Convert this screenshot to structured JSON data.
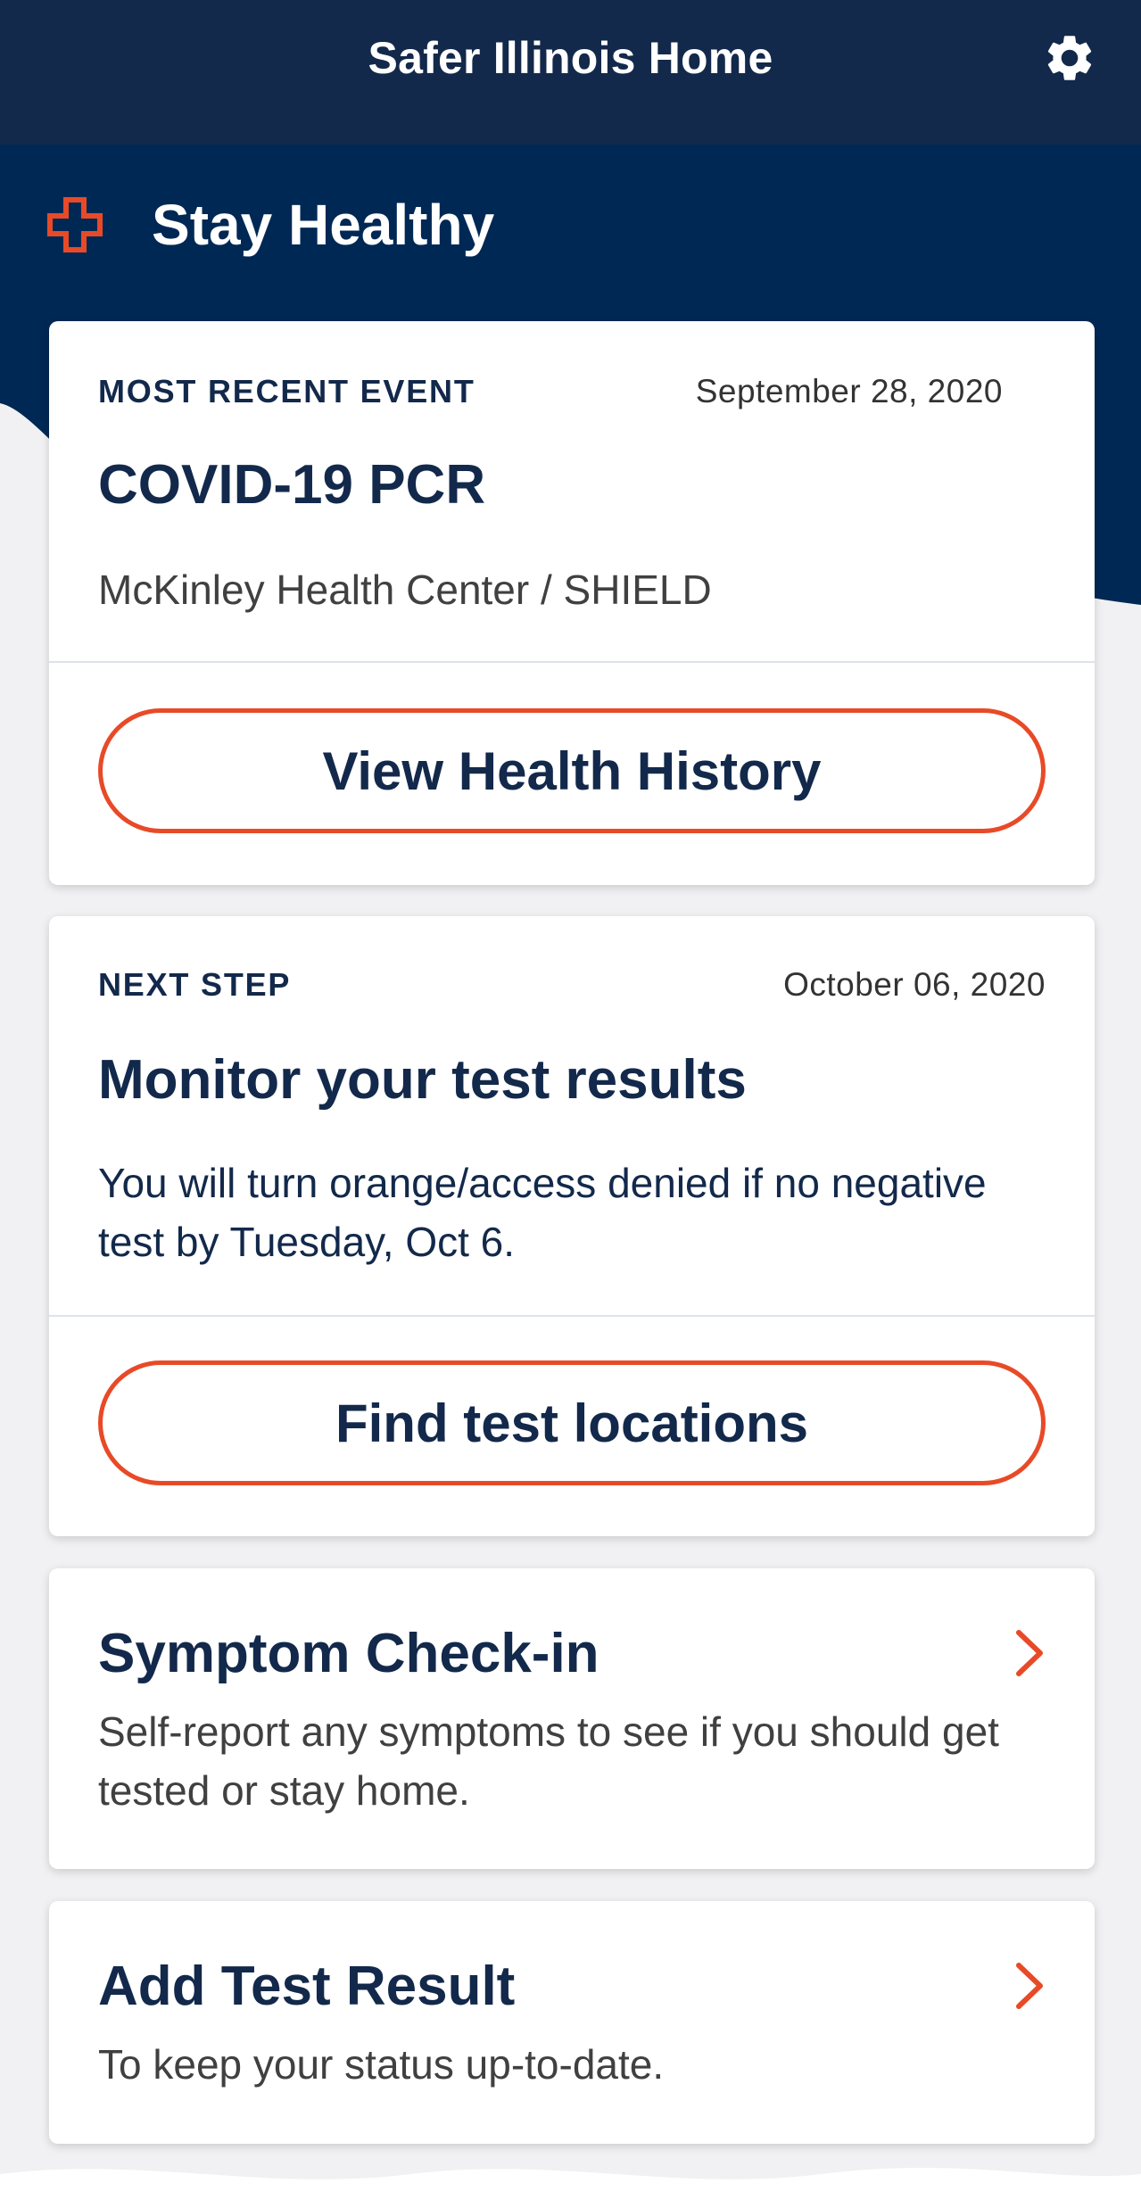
{
  "header": {
    "title": "Safer Illinois Home",
    "settings_icon": "gear-icon"
  },
  "section": {
    "title": "Stay Healthy",
    "icon": "medical-cross-icon"
  },
  "recent_event": {
    "eyebrow": "MOST RECENT EVENT",
    "date": "September 28, 2020",
    "title": "COVID-19 PCR",
    "location": "McKinley Health Center / SHIELD",
    "button_label": "View Health History"
  },
  "next_step": {
    "eyebrow": "NEXT STEP",
    "date": "October 06, 2020",
    "title": "Monitor your test results",
    "description": "You will turn orange/access denied if no negative test by Tuesday, Oct 6.",
    "button_label": "Find test locations"
  },
  "symptom_checkin": {
    "title": "Symptom Check-in",
    "description": "Self-report any symptoms to see if you should get tested or stay home.",
    "icon": "chevron-right-icon"
  },
  "add_test_result": {
    "title": "Add Test Result",
    "description": "To keep your status up-to-date.",
    "icon": "chevron-right-icon"
  },
  "colors": {
    "navy": "#13294b",
    "hero_blue": "#002855",
    "accent_orange": "#e84a27",
    "background": "#f1f1f3"
  }
}
